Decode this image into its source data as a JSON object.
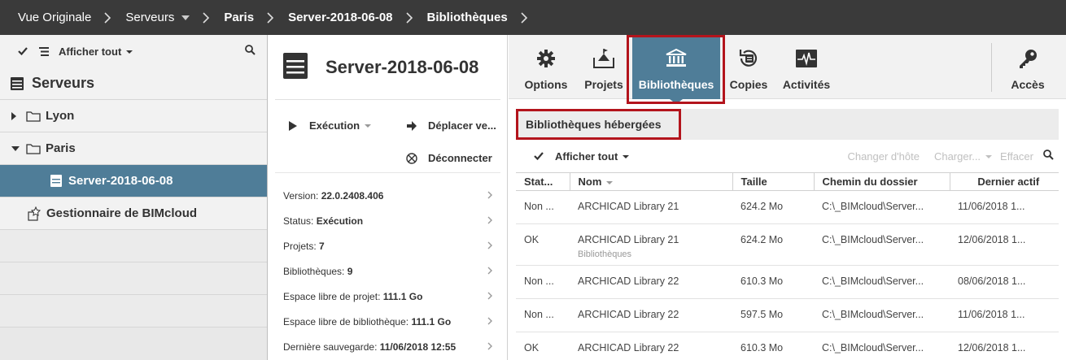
{
  "breadcrumb": {
    "items": [
      {
        "label": "Vue Originale",
        "bold": false
      },
      {
        "label": "Serveurs",
        "bold": false,
        "dropdown": true
      },
      {
        "label": "Paris",
        "bold": true
      },
      {
        "label": "Server-2018-06-08",
        "bold": true
      },
      {
        "label": "Bibliothèques",
        "bold": true
      }
    ]
  },
  "left": {
    "toolbar": {
      "filter_label": "Afficher tout"
    },
    "tree_title": "Serveurs",
    "items": [
      {
        "label": "Lyon",
        "icon": "folder-icon",
        "expanded": false
      },
      {
        "label": "Paris",
        "icon": "folder-icon",
        "expanded": true
      },
      {
        "label": "Server-2018-06-08",
        "icon": "server-icon",
        "selected": true
      },
      {
        "label": "Gestionnaire de BIMcloud",
        "icon": "bimcloud-manager-icon"
      }
    ]
  },
  "mid": {
    "title": "Server-2018-06-08",
    "actions": {
      "execution": "Exécution",
      "move": "Déplacer ve...",
      "disconnect": "Déconnecter"
    },
    "info": [
      {
        "label": "Version: ",
        "value": "22.0.2408.406"
      },
      {
        "label": "Status: ",
        "value": "Exécution"
      },
      {
        "label": "Projets: ",
        "value": "7"
      },
      {
        "label": "Bibliothèques: ",
        "value": "9"
      },
      {
        "label": "Espace libre de projet: ",
        "value": "111.1 Go"
      },
      {
        "label": "Espace libre de bibliothèque: ",
        "value": "111.1 Go"
      },
      {
        "label": "Dernière sauvegarde: ",
        "value": "11/06/2018 12:55"
      }
    ]
  },
  "tabs": {
    "options": "Options",
    "projets": "Projets",
    "bibliotheques": "Bibliothèques",
    "copies": "Copies",
    "activites": "Activités",
    "acces": "Accès"
  },
  "section": {
    "title": "Bibliothèques hébergées",
    "filter_label": "Afficher tout",
    "changer_hote": "Changer d'hôte",
    "charger": "Charger...",
    "effacer": "Effacer"
  },
  "table": {
    "headers": {
      "status": "Stat...",
      "nom": "Nom",
      "taille": "Taille",
      "chemin": "Chemin du dossier",
      "dernier": "Dernier actif"
    },
    "rows": [
      {
        "status": "Non ...",
        "nom": "ARCHICAD Library 21",
        "sub": "",
        "taille": "624.2 Mo",
        "chemin": "C:\\_BIMcloud\\Server...",
        "dernier": "11/06/2018 1..."
      },
      {
        "status": "OK",
        "nom": "ARCHICAD Library 21",
        "sub": "Bibliothèques",
        "taille": "624.2 Mo",
        "chemin": "C:\\_BIMcloud\\Server...",
        "dernier": "12/06/2018 1..."
      },
      {
        "status": "Non ...",
        "nom": "ARCHICAD Library 22",
        "sub": "",
        "taille": "610.3 Mo",
        "chemin": "C:\\_BIMcloud\\Server...",
        "dernier": "08/06/2018 1..."
      },
      {
        "status": "Non ...",
        "nom": "ARCHICAD Library 22",
        "sub": "",
        "taille": "597.5 Mo",
        "chemin": "C:\\_BIMcloud\\Server...",
        "dernier": "11/06/2018 1..."
      },
      {
        "status": "OK",
        "nom": "ARCHICAD Library 22",
        "sub": "",
        "taille": "610.3 Mo",
        "chemin": "C:\\_BIMcloud\\Server...",
        "dernier": "12/06/2018 1..."
      }
    ]
  },
  "colors": {
    "topbar": "#3a3a3a",
    "accent": "#4f7d98",
    "highlight": "#b3141c"
  }
}
